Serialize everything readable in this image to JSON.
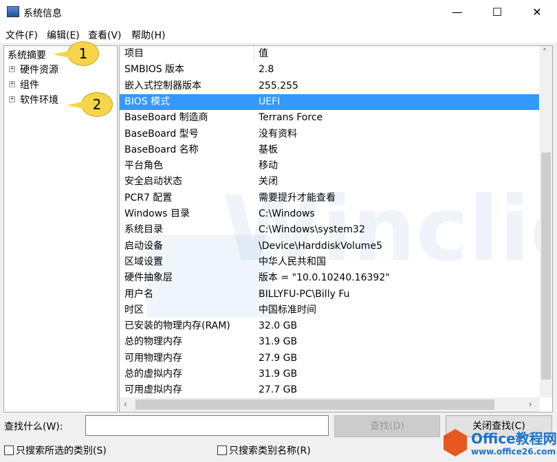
{
  "window": {
    "title": "系统信息",
    "minimize": "—",
    "maximize": "☐",
    "close": "✕"
  },
  "menu": [
    "文件(F)",
    "编辑(E)",
    "查看(V)",
    "帮助(H)"
  ],
  "tree": {
    "root": "系统摘要",
    "children": [
      "硬件资源",
      "组件",
      "软件环境"
    ]
  },
  "list": {
    "headers": [
      "项目",
      "值"
    ],
    "rows": [
      [
        "SMBIOS 版本",
        "2.8"
      ],
      [
        "嵌入式控制器版本",
        "255.255"
      ],
      [
        "BIOS 模式",
        "UEFI"
      ],
      [
        "BaseBoard 制造商",
        "Terrans Force"
      ],
      [
        "BaseBoard 型号",
        "没有资料"
      ],
      [
        "BaseBoard 名称",
        "基板"
      ],
      [
        "平台角色",
        "移动"
      ],
      [
        "安全启动状态",
        "关闭"
      ],
      [
        "PCR7 配置",
        "需要提升才能查看"
      ],
      [
        "Windows 目录",
        "C:\\Windows"
      ],
      [
        "系统目录",
        "C:\\Windows\\system32"
      ],
      [
        "启动设备",
        "\\Device\\HarddiskVolume5"
      ],
      [
        "区域设置",
        "中华人民共和国"
      ],
      [
        "硬件抽象层",
        "版本 = \"10.0.10240.16392\""
      ],
      [
        "用户名",
        "BILLYFU-PC\\Billy Fu"
      ],
      [
        "时区",
        "中国标准时间"
      ],
      [
        "已安装的物理内存(RAM)",
        "32.0 GB"
      ],
      [
        "总的物理内存",
        "31.9 GB"
      ],
      [
        "可用物理内存",
        "27.9 GB"
      ],
      [
        "总的虚拟内存",
        "31.9 GB"
      ],
      [
        "可用虚拟内存",
        "27.7 GB"
      ]
    ],
    "selected_index": 2,
    "selection_color": "#3399ff"
  },
  "callouts": [
    "1",
    "2"
  ],
  "watermark": "Winclient",
  "find": {
    "label": "查找什么(W):",
    "value": "",
    "find_button": "查找(D)",
    "close_button": "关闭查找(C)",
    "check1": "只搜索所选的类别(S)",
    "check2": "只搜索类别名称(R)"
  },
  "logo": {
    "line1": "Office教程网",
    "line2": "www.office26.com"
  }
}
